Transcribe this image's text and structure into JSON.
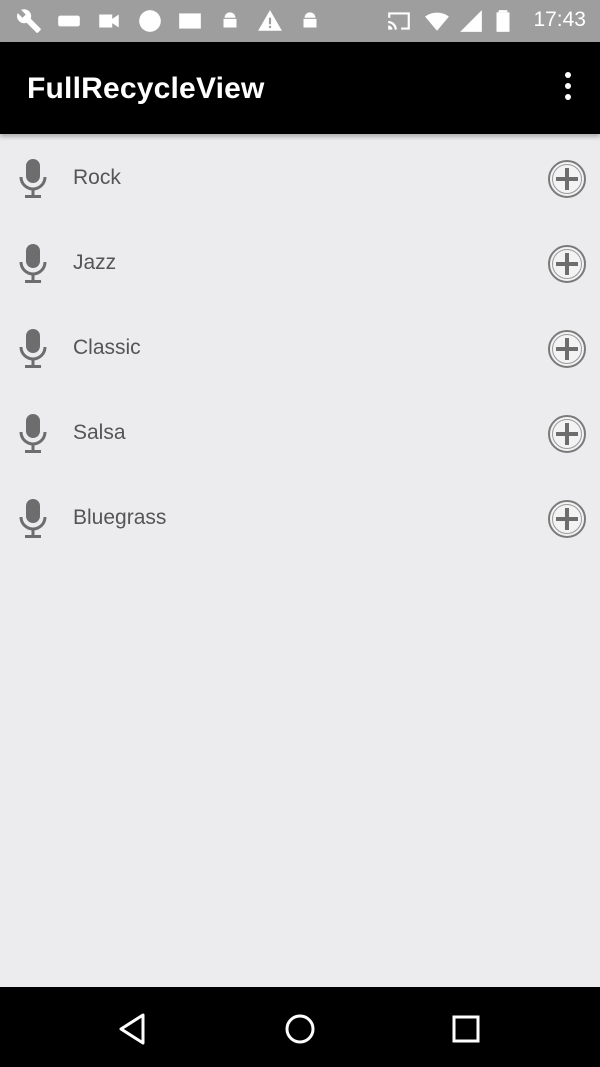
{
  "status_bar": {
    "time": "17:43",
    "icons": [
      "wrench-icon",
      "voicemail-icon",
      "video-icon",
      "chat-bubble-icon",
      "image-icon",
      "android-icon",
      "warning-icon",
      "android-icon",
      "cast-icon",
      "wifi-icon",
      "cellular-signal-icon",
      "battery-icon"
    ]
  },
  "app_bar": {
    "title": "FullRecycleView",
    "menu_icon": "overflow-menu-icon"
  },
  "genres": [
    {
      "label": "Rock"
    },
    {
      "label": "Jazz"
    },
    {
      "label": "Classic"
    },
    {
      "label": "Salsa"
    },
    {
      "label": "Bluegrass"
    }
  ],
  "nav_bar": {
    "buttons": [
      "back-icon",
      "home-icon",
      "recents-icon"
    ]
  },
  "colors": {
    "status_bar_bg": "#9e9e9e",
    "app_bar_bg": "#000000",
    "list_bg": "#ececee",
    "label_text": "#555555",
    "icon_gray": "#6d6d6d"
  }
}
